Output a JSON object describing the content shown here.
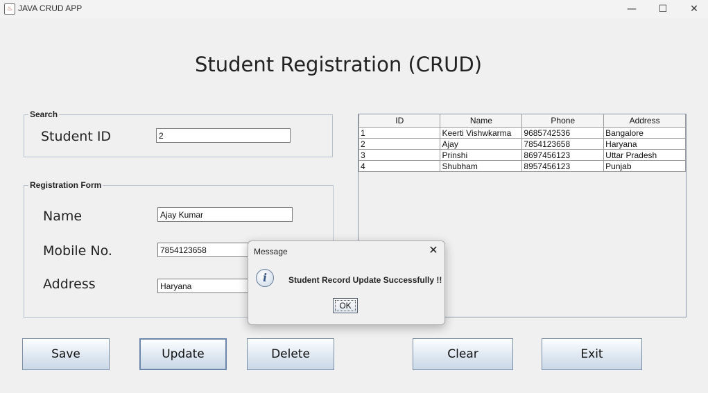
{
  "window": {
    "title": "JAVA CRUD APP",
    "minimize_glyph": "—",
    "maximize_glyph": "☐",
    "close_glyph": "✕",
    "icon": "java-icon"
  },
  "page_title": "Student Registration (CRUD)",
  "search": {
    "group_title": "Search",
    "student_id_label": "Student ID",
    "student_id_value": "2"
  },
  "form": {
    "group_title": "Registration Form",
    "name_label": "Name",
    "name_value": "Ajay Kumar",
    "mobile_label": "Mobile No.",
    "mobile_value": "7854123658",
    "address_label": "Address",
    "address_value": "Haryana"
  },
  "table": {
    "columns": [
      "ID",
      "Name",
      "Phone",
      "Address"
    ],
    "rows": [
      [
        "1",
        "Keerti Vishwkarma",
        "9685742536",
        "Bangalore"
      ],
      [
        "2",
        "Ajay",
        "7854123658",
        "Haryana"
      ],
      [
        "3",
        "Prinshi",
        "8697456123",
        "Uttar Pradesh"
      ],
      [
        "4",
        "Shubham",
        "8957456123",
        "Punjab"
      ]
    ]
  },
  "buttons": {
    "save": "Save",
    "update": "Update",
    "delete": "Delete",
    "clear": "Clear",
    "exit": "Exit"
  },
  "dialog": {
    "title": "Message",
    "close_glyph": "✕",
    "icon": "info-icon",
    "icon_glyph": "i",
    "message": "Student Record Update Successfully !!",
    "ok_label": "OK"
  }
}
